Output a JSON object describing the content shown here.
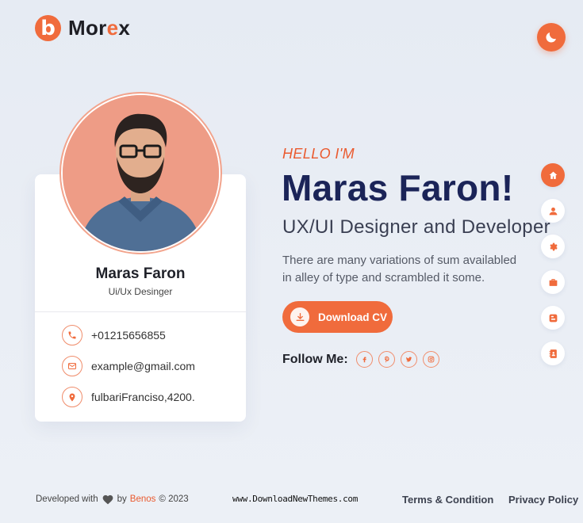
{
  "brand": {
    "logo_letter": "b",
    "name_part1": "Mor",
    "name_accent": "e",
    "name_part2": "x"
  },
  "theme_toggle": {
    "icon": "moon-icon"
  },
  "profile": {
    "name": "Maras Faron",
    "role": "Ui/Ux Desinger",
    "contacts": [
      {
        "icon": "phone-icon",
        "text": "+01215656855"
      },
      {
        "icon": "mail-icon",
        "text": "example@gmail.com"
      },
      {
        "icon": "location-pin-icon",
        "text": "fulbariFranciso,4200."
      }
    ]
  },
  "hero": {
    "greeting": "HELLO I'M",
    "name": "Maras Faron!",
    "title": "UX/UI Designer and Developer",
    "description": "There are many variations of sum availabled in alley of type and scrambled it some.",
    "download_label": "Download CV",
    "follow_label": "Follow Me:",
    "socials": [
      "facebook-icon",
      "pinterest-icon",
      "twitter-icon",
      "instagram-icon"
    ]
  },
  "side_nav": [
    {
      "icon": "home-icon",
      "active": true
    },
    {
      "icon": "user-icon",
      "active": false
    },
    {
      "icon": "gear-icon",
      "active": false
    },
    {
      "icon": "briefcase-icon",
      "active": false
    },
    {
      "icon": "blog-icon",
      "active": false
    },
    {
      "icon": "contact-book-icon",
      "active": false
    }
  ],
  "footer": {
    "developed_with": "Developed with",
    "by": "by",
    "author": "Benos",
    "copyright": "© 2023",
    "watermark": "www.DownloadNewThemes.com",
    "terms": "Terms & Condition",
    "privacy": "Privacy Policy"
  },
  "colors": {
    "accent": "#f06b3c",
    "navy": "#1b2458",
    "background": "#e8edf4"
  }
}
